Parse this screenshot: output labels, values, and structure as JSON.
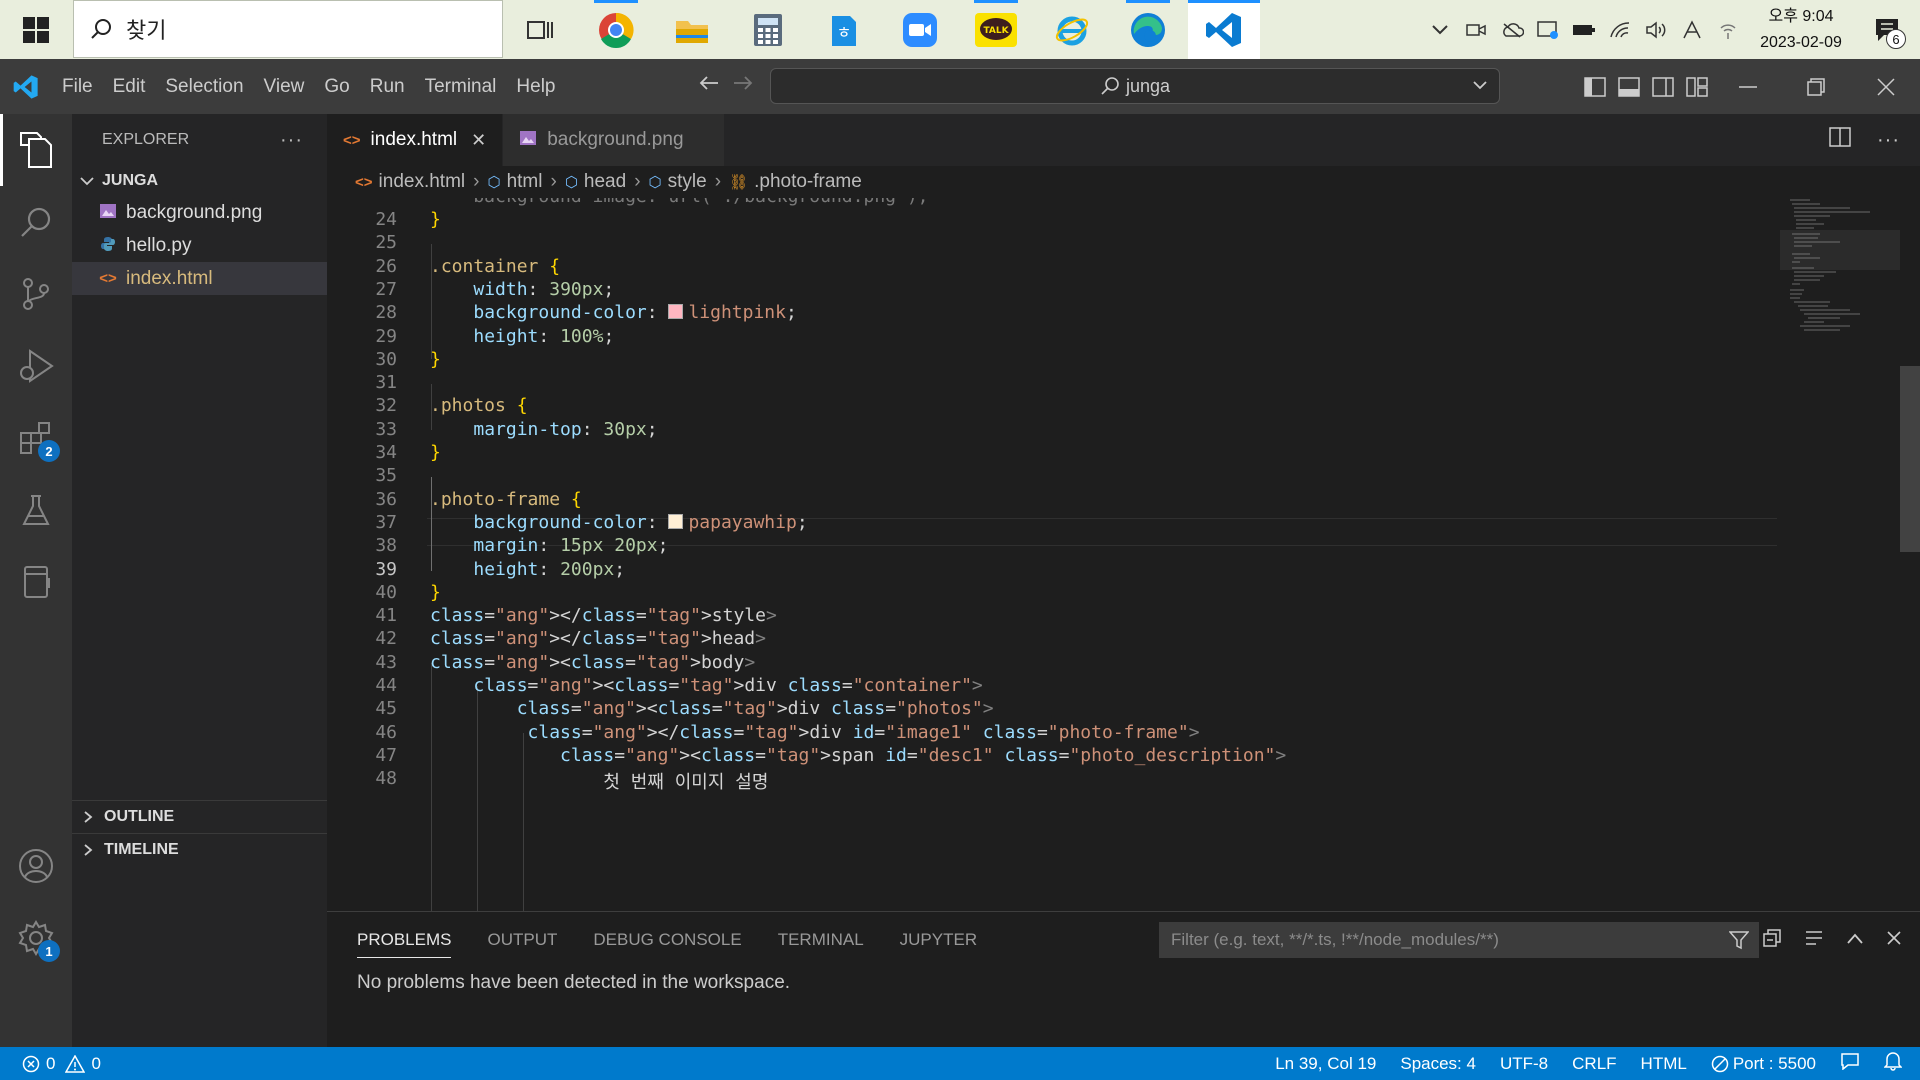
{
  "taskbar": {
    "search_placeholder": "찾기",
    "clock_time": "오후 9:04",
    "clock_date": "2023-02-09",
    "notification_count": "6"
  },
  "titlebar": {
    "menus": [
      "File",
      "Edit",
      "Selection",
      "View",
      "Go",
      "Run",
      "Terminal",
      "Help"
    ],
    "command_center": "junga"
  },
  "activity": {
    "extensions_badge": "2",
    "settings_badge": "1"
  },
  "sidebar": {
    "title": "EXPLORER",
    "folder": "JUNGA",
    "files": [
      "background.png",
      "hello.py",
      "index.html"
    ],
    "outline": "OUTLINE",
    "timeline": "TIMELINE"
  },
  "tabs": [
    "index.html",
    "background.png"
  ],
  "breadcrumb": [
    "index.html",
    "html",
    "head",
    "style",
    ".photo-frame"
  ],
  "editor": {
    "partial_top": "    background-image: url(\"./background.png\");",
    "line_numbers": [
      "24",
      "25",
      "26",
      "27",
      "28",
      "29",
      "30",
      "31",
      "32",
      "33",
      "34",
      "35",
      "36",
      "37",
      "38",
      "39",
      "40",
      "41",
      "42",
      "43",
      "44",
      "45",
      "46",
      "47",
      "48"
    ],
    "current_line": "39",
    "lines": [
      "}",
      "",
      ".container {",
      "    width: 390px;",
      "    background-color: lightpink;",
      "    height: 100%;",
      "}",
      "",
      ".photos {",
      "    margin-top: 30px;",
      "}",
      "",
      ".photo-frame {",
      "    background-color: papayawhip;",
      "    margin: 15px 20px;",
      "    height: 200px;",
      "}",
      "</style>",
      "</head>",
      "<body>",
      "    <div class=\"container\">",
      "        <div class=\"photos\">",
      "         </div id=\"image1\" class=\"photo-frame\">",
      "            <span id=\"desc1\" class=\"photo_description\">",
      "                첫 번째 이미지 설명"
    ],
    "swatch_lightpink": "#ffb6c1",
    "swatch_papayawhip": "#ffefd5"
  },
  "panel": {
    "tabs": [
      "PROBLEMS",
      "OUTPUT",
      "DEBUG CONSOLE",
      "TERMINAL",
      "JUPYTER"
    ],
    "filter_placeholder": "Filter (e.g. text, **/*.ts, !**/node_modules/**)",
    "message": "No problems have been detected in the workspace."
  },
  "statusbar": {
    "errors": "0",
    "warnings": "0",
    "position": "Ln 39, Col 19",
    "spaces": "Spaces: 4",
    "encoding": "UTF-8",
    "eol": "CRLF",
    "language": "HTML",
    "port": "Port : 5500"
  },
  "colors": {
    "accent": "#007acc",
    "activity_bg": "#333333",
    "sidebar_bg": "#252526",
    "editor_bg": "#1e1e1e"
  }
}
